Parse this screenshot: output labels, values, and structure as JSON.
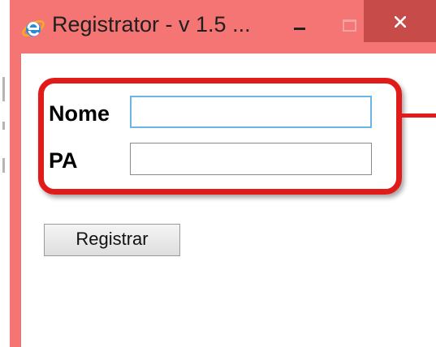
{
  "window": {
    "title": "Registrator - v 1.5 ...",
    "icon": "internet-explorer-icon",
    "frame_color": "#f47574",
    "close_button_color": "#c64b49"
  },
  "form": {
    "name_label": "Nome",
    "name_value": "",
    "pa_label": "PA",
    "pa_value": "",
    "submit_label": "Registrar"
  },
  "annotation": {
    "highlight_color": "#e11a1a"
  }
}
